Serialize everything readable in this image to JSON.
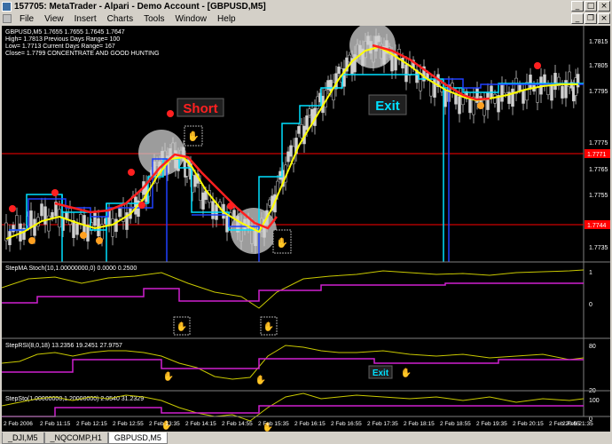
{
  "window": {
    "title": "157705: MetaTrader - Alpari - Demo Account - [GBPUSD,M5]"
  },
  "menu": {
    "items": [
      "File",
      "View",
      "Insert",
      "Charts",
      "Tools",
      "Window",
      "Help"
    ]
  },
  "chart": {
    "info_lines": [
      "GBPUSD,M5  1.7655 1.7655 1.7645 1.7647",
      "High= 1.7813    Previous Days Range= 100",
      "Low= 1.7713     Current Days Range= 167",
      "Close= 1.7799   CONCENTRATE AND GOOD HUNTING"
    ],
    "price_ticks": [
      "1.7815",
      "1.7805",
      "1.7795",
      "1.7775",
      "1.7765",
      "1.7755",
      "1.7745",
      "1.7735"
    ],
    "current_price_tags": [
      "1.7771",
      "1.7744"
    ],
    "annotations": {
      "short": "Short",
      "exit": "Exit"
    },
    "subwindows": [
      {
        "label": "StepMA Stoch(10,1.00000000,0) 0.0000 0.2500",
        "ticks": [
          "1",
          "0"
        ]
      },
      {
        "label": "StepRSI(8,0,18) 13.2356 19.2451 27.9757",
        "ticks": [
          "80",
          "20"
        ],
        "exit": "Exit"
      },
      {
        "label": "StepSto(1.00000000,1.20000000) 2.0540 31.2329",
        "ticks": [
          "100",
          "0"
        ]
      }
    ],
    "time_ticks": [
      "2 Feb 2006",
      "2 Feb 11:15",
      "2 Feb 12:15",
      "2 Feb 12:55",
      "2 Feb 13:35",
      "2 Feb 14:15",
      "2 Feb 14:55",
      "2 Feb 15:35",
      "2 Feb 16:15",
      "2 Feb 16:55",
      "2 Feb 17:35",
      "2 Feb 18:15",
      "2 Feb 18:55",
      "2 Feb 19:35",
      "2 Feb 20:15",
      "2 Feb 20:55",
      "2 Feb 21:35"
    ]
  },
  "tabs": [
    "_DJI,M5",
    "_NQCOMP,H1",
    "GBPUSD,M5"
  ],
  "active_tab": 2
}
